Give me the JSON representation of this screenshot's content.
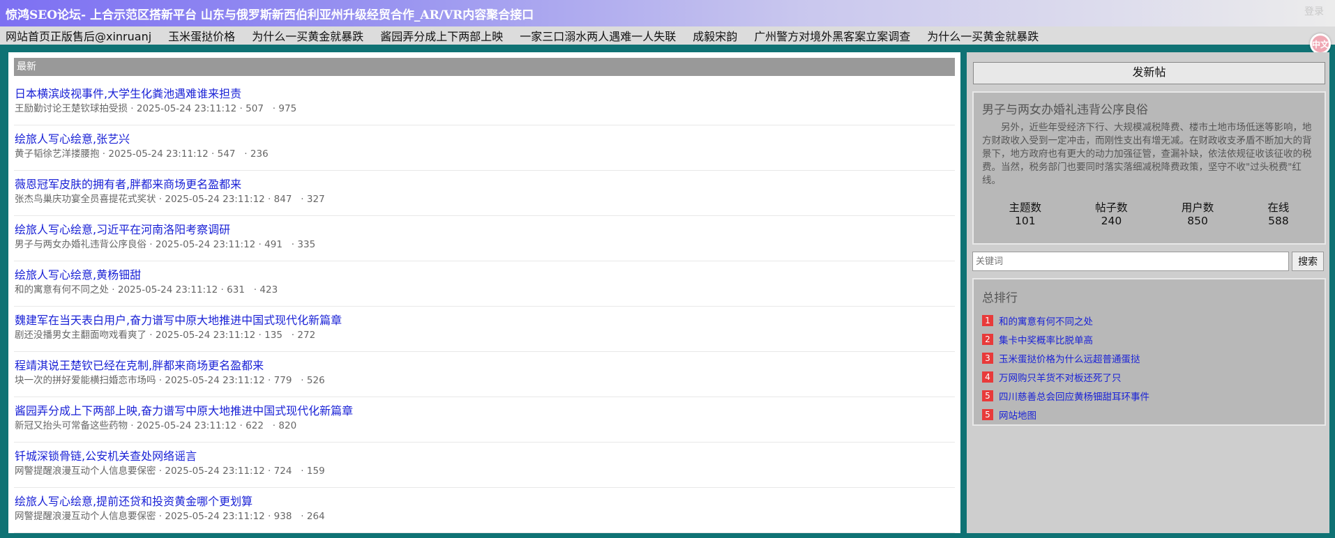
{
  "header": {
    "site_title": "惊鸿SEO论坛- 上合示范区搭新平台 山东与俄罗斯新西伯利亚州升级经贸合作_AR/VR内容聚合接口",
    "login_label": "登录"
  },
  "nav": {
    "items": [
      {
        "label": "网站首页正版售后@xinruanj"
      },
      {
        "label": "玉米蛋挞价格"
      },
      {
        "label": "为什么一买黄金就暴跌"
      },
      {
        "label": "酱园弄分成上下两部上映"
      },
      {
        "label": "一家三口溺水两人遇难一人失联"
      },
      {
        "label": "成毅宋韵"
      },
      {
        "label": "广州警方对境外黑客案立案调查"
      },
      {
        "label": "为什么一买黄金就暴跌"
      }
    ]
  },
  "lang_badge": "中文",
  "main": {
    "section_label": "最新",
    "posts": [
      {
        "title": "日本横滨歧视事件,大学生化粪池遇难谁来担责",
        "author": "王励勤讨论王楚钦球拍受损",
        "date": "2025-05-24 23:11:12",
        "views": "507",
        "replies": "975"
      },
      {
        "title": "绘旅人写心绘意,张艺兴",
        "author": "黄子韬徐艺洋搂腰抱",
        "date": "2025-05-24 23:11:12",
        "views": "547",
        "replies": "236"
      },
      {
        "title": "薇恩冠军皮肤的拥有者,胖都来商场更名盈都来",
        "author": "张杰鸟巢庆功宴全员喜提花式奖状",
        "date": "2025-05-24 23:11:12",
        "views": "847",
        "replies": "327"
      },
      {
        "title": "绘旅人写心绘意,习近平在河南洛阳考察调研",
        "author": "男子与两女办婚礼违背公序良俗",
        "date": "2025-05-24 23:11:12",
        "views": "491",
        "replies": "335"
      },
      {
        "title": "绘旅人写心绘意,黄杨钿甜",
        "author": "和的寓意有何不同之处",
        "date": "2025-05-24 23:11:12",
        "views": "631",
        "replies": "423"
      },
      {
        "title": "魏建军在当天表白用户,奋力谱写中原大地推进中国式现代化新篇章",
        "author": "剧还没播男女主翻面吻戏看爽了",
        "date": "2025-05-24 23:11:12",
        "views": "135",
        "replies": "272"
      },
      {
        "title": "程靖淇说王楚钦已经在克制,胖都来商场更名盈都来",
        "author": "块一次的拼好爱能横扫婚恋市场吗",
        "date": "2025-05-24 23:11:12",
        "views": "779",
        "replies": "526"
      },
      {
        "title": "酱园弄分成上下两部上映,奋力谱写中原大地推进中国式现代化新篇章",
        "author": "新冠又抬头可常备这些药物",
        "date": "2025-05-24 23:11:12",
        "views": "622",
        "replies": "820"
      },
      {
        "title": "钎城深锁骨链,公安机关查处网络谣言",
        "author": "网警提醒浪漫互动个人信息要保密",
        "date": "2025-05-24 23:11:12",
        "views": "724",
        "replies": "159"
      },
      {
        "title": "绘旅人写心绘意,提前还贷和投资黄金哪个更划算",
        "author": "网警提醒浪漫互动个人信息要保密",
        "date": "2025-05-24 23:11:12",
        "views": "938",
        "replies": "264"
      }
    ]
  },
  "sidebar": {
    "new_post_label": "发新帖",
    "info": {
      "title": "男子与两女办婚礼违背公序良俗",
      "text": "另外，近些年受经济下行、大规模减税降费、楼市土地市场低迷等影响，地方财政收入受到一定冲击，而刚性支出有增无减。在财政收支矛盾不断加大的背景下，地方政府也有更大的动力加强征管，查漏补缺，依法依规征收该征收的税费。当然，税务部门也要同时落实落细减税降费政策，坚守不收\"过头税费\"红线。",
      "stats": [
        {
          "label": "主题数",
          "value": "101"
        },
        {
          "label": "帖子数",
          "value": "240"
        },
        {
          "label": "用户数",
          "value": "850"
        },
        {
          "label": "在线",
          "value": "588"
        }
      ]
    },
    "search": {
      "placeholder": "关键词",
      "button_label": "搜索"
    },
    "ranking": {
      "title": "总排行",
      "items": [
        {
          "num": "1",
          "label": "和的寓意有何不同之处"
        },
        {
          "num": "2",
          "label": "集卡中奖概率比脱单高"
        },
        {
          "num": "3",
          "label": "玉米蛋挞价格为什么远超普通蛋挞"
        },
        {
          "num": "4",
          "label": "万网购只羊货不对板还死了只"
        },
        {
          "num": "5",
          "label": "四川慈善总会回应黄杨钿甜耳环事件"
        },
        {
          "num": "5",
          "label": "网站地图"
        }
      ]
    }
  }
}
